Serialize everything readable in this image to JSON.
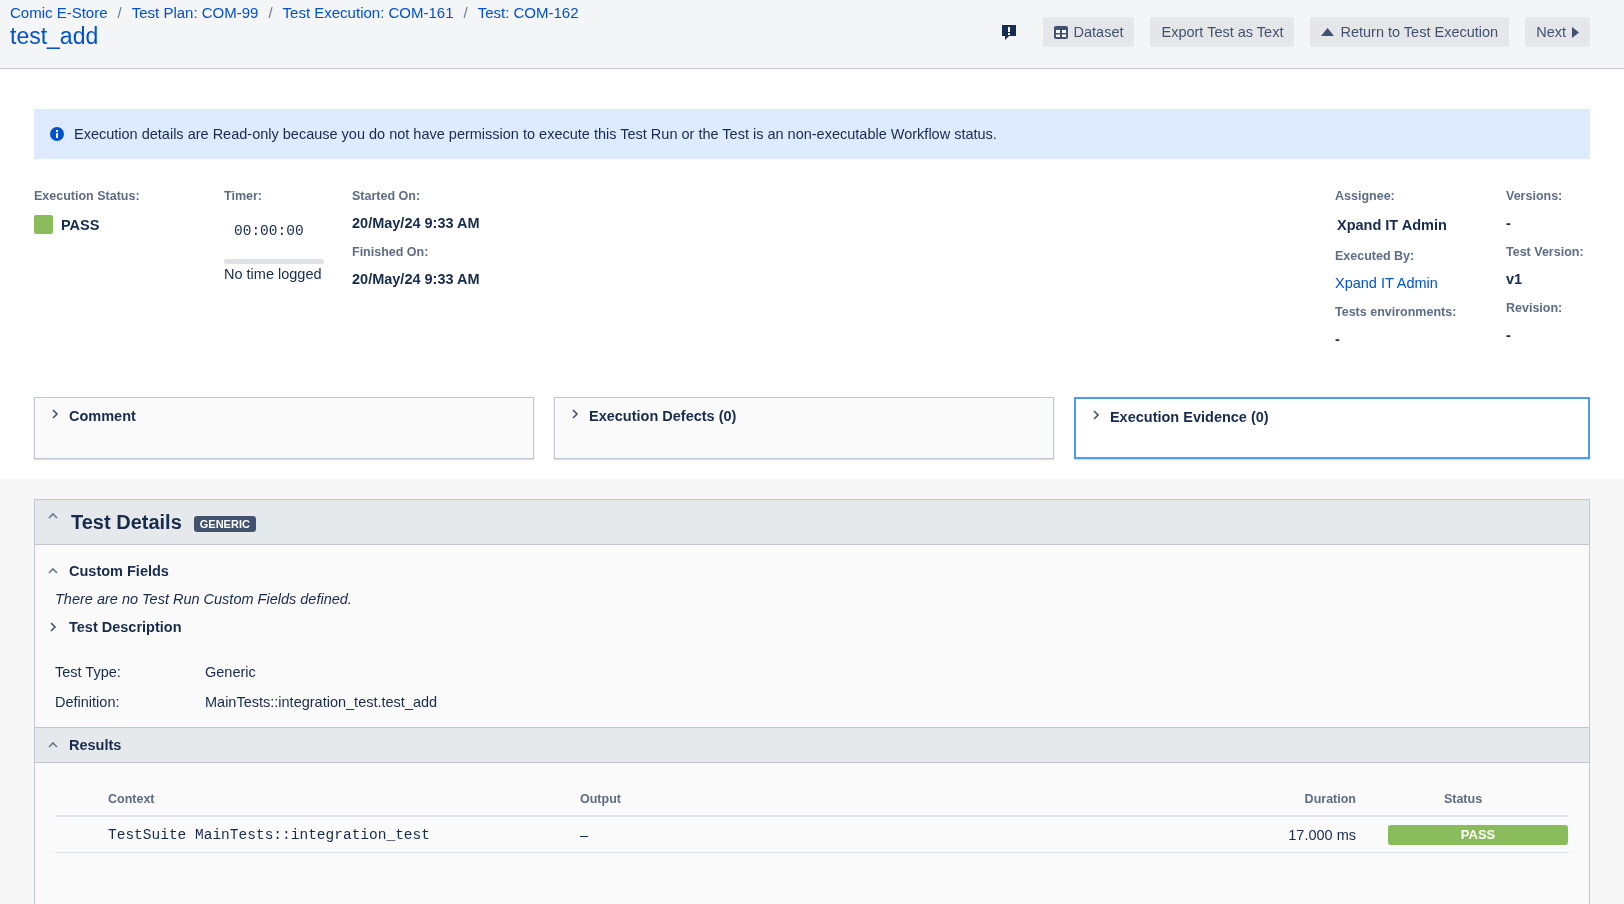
{
  "breadcrumbs": [
    "Comic E-Store",
    "Test Plan: COM-99",
    "Test Execution: COM-161",
    "Test: COM-162"
  ],
  "page_title": "test_add",
  "breadcrumb_separator": "/",
  "toolbar": [
    {
      "kind": "icon"
    },
    {
      "kind": "dataset",
      "label": "Dataset"
    },
    {
      "kind": "plain",
      "label": "Export Test as Text"
    },
    {
      "kind": "up",
      "label": "Return to Test Execution"
    },
    {
      "kind": "next",
      "label": "Next"
    }
  ],
  "info_banner": "Execution details are Read-only because you do not have permission to execute this Test Run or the Test is an non-executable Workflow status.",
  "execution_status": {
    "label": "Execution Status:",
    "value": "PASS",
    "color": "#8bbc5c"
  },
  "timer": {
    "label": "Timer:",
    "value": "00:00:00",
    "note": "No time logged"
  },
  "started_on": {
    "label": "Started On:",
    "value": "20/May/24 9:33 AM"
  },
  "finished_on": {
    "label": "Finished On:",
    "value": "20/May/24 9:33 AM"
  },
  "assignee": {
    "label": "Assignee:",
    "value": "Xpand IT Admin"
  },
  "executed_by": {
    "label": "Executed By:",
    "value": "Xpand IT Admin"
  },
  "tests_environments": {
    "label": "Tests environments:",
    "value": "-"
  },
  "versions": {
    "label": "Versions:",
    "value": "-"
  },
  "test_version": {
    "label": "Test Version:",
    "value": "v1"
  },
  "revision": {
    "label": "Revision:",
    "value": "-"
  },
  "panels": [
    {
      "title": "Comment",
      "expanded": false,
      "selected": false
    },
    {
      "title": "Execution Defects (0)",
      "expanded": false,
      "selected": false
    },
    {
      "title": "Execution Evidence (0)",
      "expanded": false,
      "selected": true
    }
  ],
  "test_details": {
    "title": "Test Details",
    "badge": "GENERIC",
    "expanded": true,
    "custom_fields": {
      "title": "Custom Fields",
      "expanded": true,
      "message": "There are no Test Run Custom Fields defined."
    },
    "test_description": {
      "title": "Test Description",
      "expanded": false
    },
    "fields": [
      {
        "label": "Test Type:",
        "value": "Generic"
      },
      {
        "label": "Definition:",
        "value": "MainTests::integration_test.test_add"
      }
    ],
    "results": {
      "title": "Results",
      "expanded": true,
      "columns": [
        "Context",
        "Output",
        "Duration",
        "Status"
      ],
      "rows": [
        {
          "context": "TestSuite MainTests::integration_test",
          "output": "–",
          "duration": "17.000 ms",
          "status": "PASS",
          "color": "#8bbc5c"
        }
      ]
    }
  }
}
